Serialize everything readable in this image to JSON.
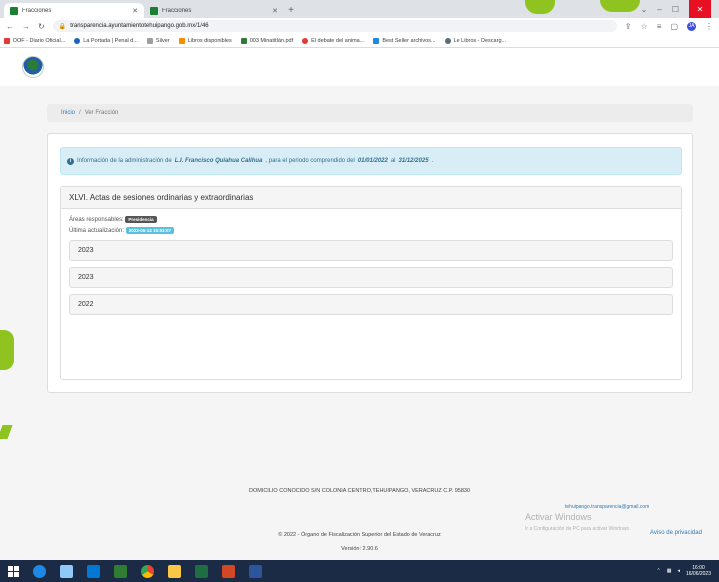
{
  "browser": {
    "tabs": [
      {
        "title": "Fracciones",
        "active": true
      },
      {
        "title": "Fracciones",
        "active": false
      }
    ],
    "url": "transparencia.ayuntamientotehuipango.gob.mx/1/46",
    "profile_initial": "JA",
    "bookmarks": [
      {
        "label": "DOF - Diario Oficial...",
        "color": "#e53935"
      },
      {
        "label": "La Portada | Penal d...",
        "color": "#1565c0"
      },
      {
        "label": "Silver",
        "color": "#9e9e9e"
      },
      {
        "label": "Libros disponibles",
        "color": "#fb8c00"
      },
      {
        "label": "003 Minatitlán.pdf",
        "color": "#2e7d32"
      },
      {
        "label": "El debate del anima...",
        "color": "#e53935"
      },
      {
        "label": "Best Seller archivos...",
        "color": "#1e88e5"
      },
      {
        "label": "Le Libros - Descarg...",
        "color": "#546e7a"
      }
    ]
  },
  "breadcrumb": {
    "home": "Inicio",
    "separator": "/",
    "current": "Ver Fracción"
  },
  "alert": {
    "prefix": "Información de la administración de",
    "name": "L.I. Francisco Quiahua Calihua",
    "middle": ", para el periodo comprendido del",
    "start": "01/01/2022",
    "conj": "al",
    "end": "31/12/2025",
    "suffix": "."
  },
  "fraction": {
    "title": "XLVI. Actas de sesiones ordinarias y extraordinarias",
    "areas_label": "Áreas responsables:",
    "area_badge": "Presidencia",
    "updated_label": "Última actualización:",
    "updated_badge": "2023-05-14 15:53:07",
    "years": [
      "2023",
      "2023",
      "2022"
    ]
  },
  "footer": {
    "address": "DOMICILIO CONOCIDO S/N COLONIA CENTRO,TEHUIPANGO, VERACRUZ C.P. 95830",
    "email": "tehuipango.transparencia@gmail.com",
    "copyright": "© 2022 - Órgano de Fiscalización Superior del Estado de Veracruz",
    "version": "Versión: 2.90.6",
    "privacy": "Aviso de privacidad"
  },
  "windows": {
    "activate_title": "Activar Windows",
    "activate_sub": "Ir a Configuración de PC para activar Windows.",
    "time": "16:00",
    "date": "16/06/2023"
  }
}
